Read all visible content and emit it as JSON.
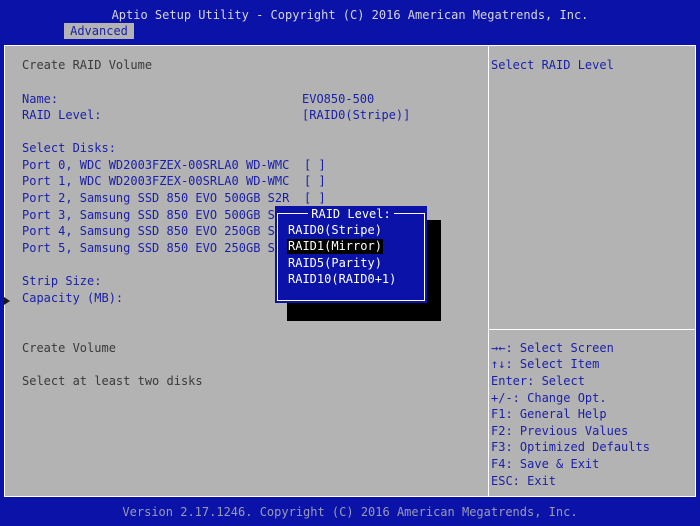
{
  "header": {
    "title": "Aptio Setup Utility - Copyright (C) 2016 American Megatrends, Inc.",
    "tab_label": "Advanced"
  },
  "main": {
    "section_title": "Create RAID Volume",
    "name_label": "Name:",
    "name_value": "EVO850-500",
    "raid_level_label": "RAID Level:",
    "raid_level_value": "[RAID0(Stripe)]",
    "select_disks_label": "Select Disks:",
    "disks": [
      {
        "label": "Port 0, WDC WD2003FZEX-00SRLA0 WD-WMC",
        "value": "[ ]"
      },
      {
        "label": "Port 1, WDC WD2003FZEX-00SRLA0 WD-WMC",
        "value": "[ ]"
      },
      {
        "label": "Port 2, Samsung SSD 850 EVO 500GB S2R",
        "value": "[ ]"
      },
      {
        "label": "Port 3, Samsung SSD 850 EVO 500GB S2"
      },
      {
        "label": "Port 4, Samsung SSD 850 EVO 250GB S2"
      },
      {
        "label": "Port 5, Samsung SSD 850 EVO 250GB S2"
      }
    ],
    "strip_size_label": "Strip Size:",
    "capacity_label": "Capacity (MB):",
    "create_volume_label": "Create Volume",
    "hint_text": "Select at least two disks"
  },
  "help": {
    "description": "Select RAID Level",
    "keys": [
      "→←: Select Screen",
      "↑↓: Select Item",
      "Enter: Select",
      "+/-: Change Opt.",
      "F1: General Help",
      "F2: Previous Values",
      "F3: Optimized Defaults",
      "F4: Save & Exit",
      "ESC: Exit"
    ]
  },
  "popup": {
    "title": "RAID Level:",
    "options": [
      "RAID0(Stripe)",
      "RAID1(Mirror)",
      "RAID5(Parity)",
      "RAID10(RAID0+1)"
    ],
    "selected_index": 1
  },
  "footer": {
    "version": "Version 2.17.1246. Copyright (C) 2016 American Megatrends, Inc."
  },
  "colors": {
    "background_blue": "#0a12a8",
    "panel_gray": "#b3b3b3",
    "highlight_black": "#000000",
    "text_blue": "#1a1fa8"
  },
  "icons": {
    "create_volume_marker": "triangle-right-icon"
  }
}
